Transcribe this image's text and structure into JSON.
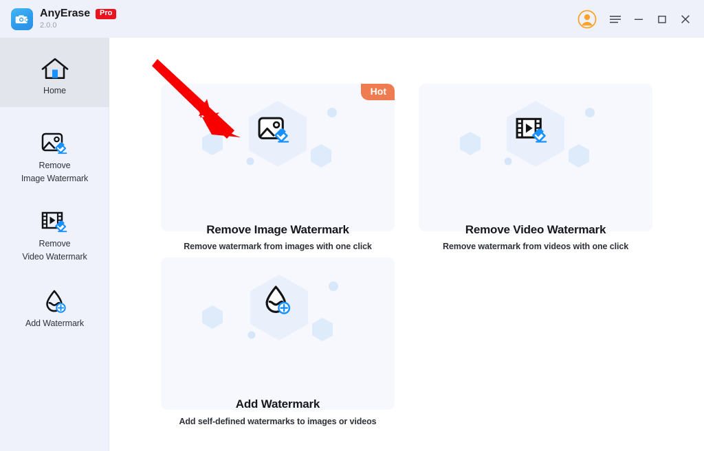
{
  "window": {
    "app_name": "AnyErase",
    "edition_badge": "Pro",
    "version": "2.0.0",
    "logo_icon": "camera-eraser-icon",
    "controls": {
      "account_icon": "user-avatar-icon",
      "menu_icon": "hamburger-menu-icon",
      "minimize_icon": "minimize-icon",
      "maximize_icon": "maximize-icon",
      "close_icon": "close-icon"
    },
    "colors": {
      "titlebar_bg": "#EEF1FA",
      "sidebar_bg": "#EFF2FB",
      "sidebar_active_bg": "#E2E5EC",
      "card_bg": "#F6F8FD",
      "accent_blue": "#1890FF",
      "pro_red": "#E8131F",
      "hot_orange": "#EF7C51",
      "avatar_orange": "#FBA328",
      "annotation_red": "#F80000"
    }
  },
  "sidebar": {
    "items": [
      {
        "id": "home",
        "label": "Home",
        "icon": "home-icon",
        "active": true
      },
      {
        "id": "remove-image-watermark",
        "label": "Remove\nImage Watermark",
        "line1": "Remove",
        "line2": "Image Watermark",
        "icon": "image-eraser-icon",
        "active": false
      },
      {
        "id": "remove-video-watermark",
        "label": "Remove\nVideo Watermark",
        "line1": "Remove",
        "line2": "Video Watermark",
        "icon": "video-eraser-icon",
        "active": false
      },
      {
        "id": "add-watermark",
        "label": "Add Watermark",
        "line1": "Add Watermark",
        "line2": "",
        "icon": "droplet-plus-icon",
        "active": false
      }
    ]
  },
  "main": {
    "cards": [
      {
        "id": "remove-image-watermark",
        "title": "Remove Image Watermark",
        "subtitle": "Remove watermark from images with one click",
        "badge": "Hot",
        "icon": "image-eraser-icon"
      },
      {
        "id": "remove-video-watermark",
        "title": "Remove Video Watermark",
        "subtitle": "Remove watermark from videos with one click",
        "badge": "",
        "icon": "video-eraser-icon"
      },
      {
        "id": "add-watermark",
        "title": "Add Watermark",
        "subtitle": "Add self-defined watermarks to images or videos",
        "badge": "",
        "icon": "droplet-plus-icon"
      }
    ]
  },
  "annotation": {
    "type": "arrow",
    "points_to": "Remove Image Watermark card"
  }
}
